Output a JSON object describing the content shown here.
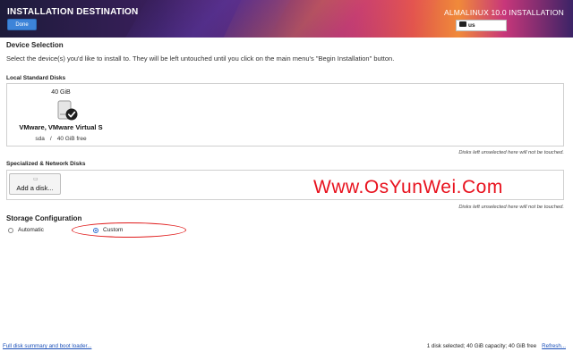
{
  "header": {
    "title": "INSTALLATION DESTINATION",
    "done_label": "Done",
    "distro": "ALMALINUX 10.0 INSTALLATION",
    "keyboard_layout": "us"
  },
  "device_selection": {
    "heading": "Device Selection",
    "description": "Select the device(s) you'd like to install to.  They will be left untouched until you click on the main menu's \"Begin Installation\" button."
  },
  "local_disks": {
    "heading": "Local Standard Disks",
    "disks": [
      {
        "size": "40 GiB",
        "name": "VMware, VMware Virtual S",
        "device": "sda",
        "separator": "/",
        "free": "40 GiB free",
        "selected": true
      }
    ],
    "note": "Disks left unselected here will not be touched."
  },
  "network_disks": {
    "heading": "Specialized & Network Disks",
    "add_label": "Add a disk...",
    "note": "Disks left unselected here will not be touched."
  },
  "storage": {
    "heading": "Storage Configuration",
    "options": [
      {
        "label": "Automatic",
        "selected": false
      },
      {
        "label": "Custom",
        "selected": true
      }
    ]
  },
  "watermark": "Www.OsYunWei.Com",
  "footer": {
    "summary_link": "Full disk summary and boot loader...",
    "status": "1 disk selected; 40 GiB capacity; 40 GiB free",
    "refresh": "Refresh..."
  },
  "colors": {
    "accent": "#3d84d9",
    "link": "#1a4fb8",
    "annotation": "#e01a1a",
    "watermark": "#e8121e"
  }
}
